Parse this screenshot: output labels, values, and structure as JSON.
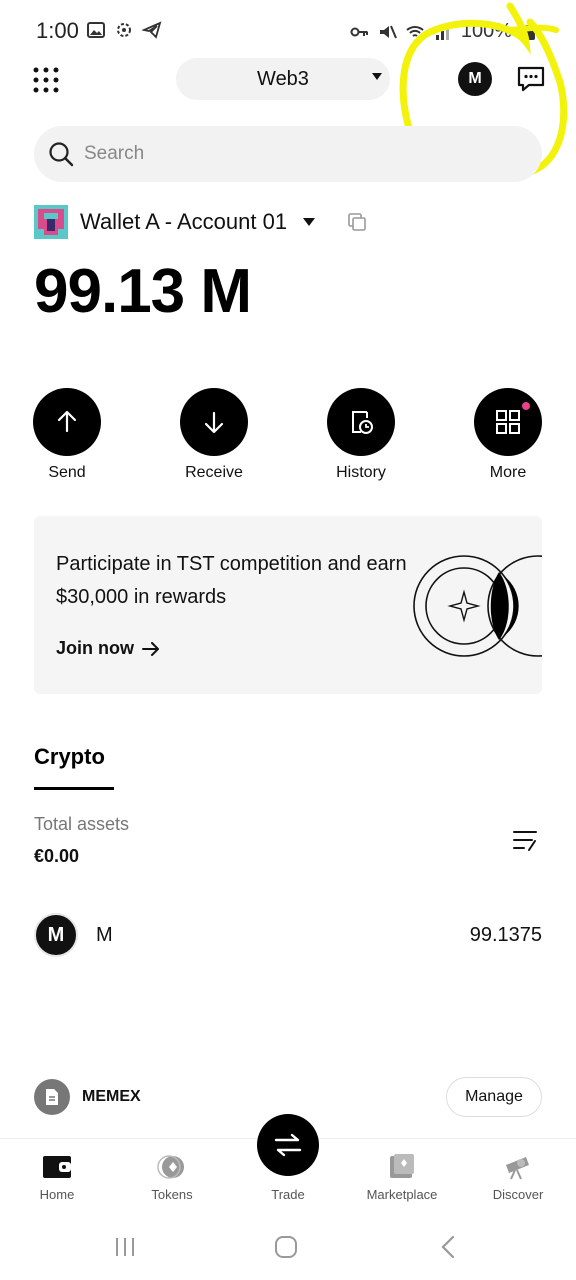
{
  "status_bar": {
    "time": "1:00",
    "battery": "100%"
  },
  "header": {
    "network_label": "Web3",
    "avatar_letter": "M"
  },
  "search": {
    "placeholder": "Search"
  },
  "account": {
    "name": "Wallet A - Account 01",
    "balance": "99.13 M"
  },
  "actions": [
    {
      "label": "Send"
    },
    {
      "label": "Receive"
    },
    {
      "label": "History"
    },
    {
      "label": "More"
    }
  ],
  "promo": {
    "text": "Participate in TST competition and earn $30,000 in rewards",
    "cta": "Join now"
  },
  "assets": {
    "tab_label": "Crypto",
    "total_label": "Total assets",
    "total_value": "€0.00",
    "tokens": [
      {
        "avatar_letter": "M",
        "name": "M",
        "amount": "99.1375"
      }
    ]
  },
  "memex": {
    "label": "MEMEX",
    "manage_label": "Manage"
  },
  "bottom_nav": {
    "items": [
      {
        "label": "Home"
      },
      {
        "label": "Tokens"
      },
      {
        "label": "Trade"
      },
      {
        "label": "Marketplace"
      },
      {
        "label": "Discover"
      }
    ]
  },
  "colors": {
    "annotation_highlight": "#f2f20a",
    "notification_dot": "#e8438a"
  },
  "icons": [
    "apps-grid-icon",
    "chat-icon",
    "search-icon",
    "copy-icon",
    "send-arrow-icon",
    "receive-arrow-icon",
    "history-icon",
    "more-grid-icon",
    "arrow-right-icon",
    "sort-icon",
    "home-wallet-icon",
    "tokens-icon",
    "trade-swap-icon",
    "marketplace-icon",
    "discover-telescope-icon"
  ]
}
